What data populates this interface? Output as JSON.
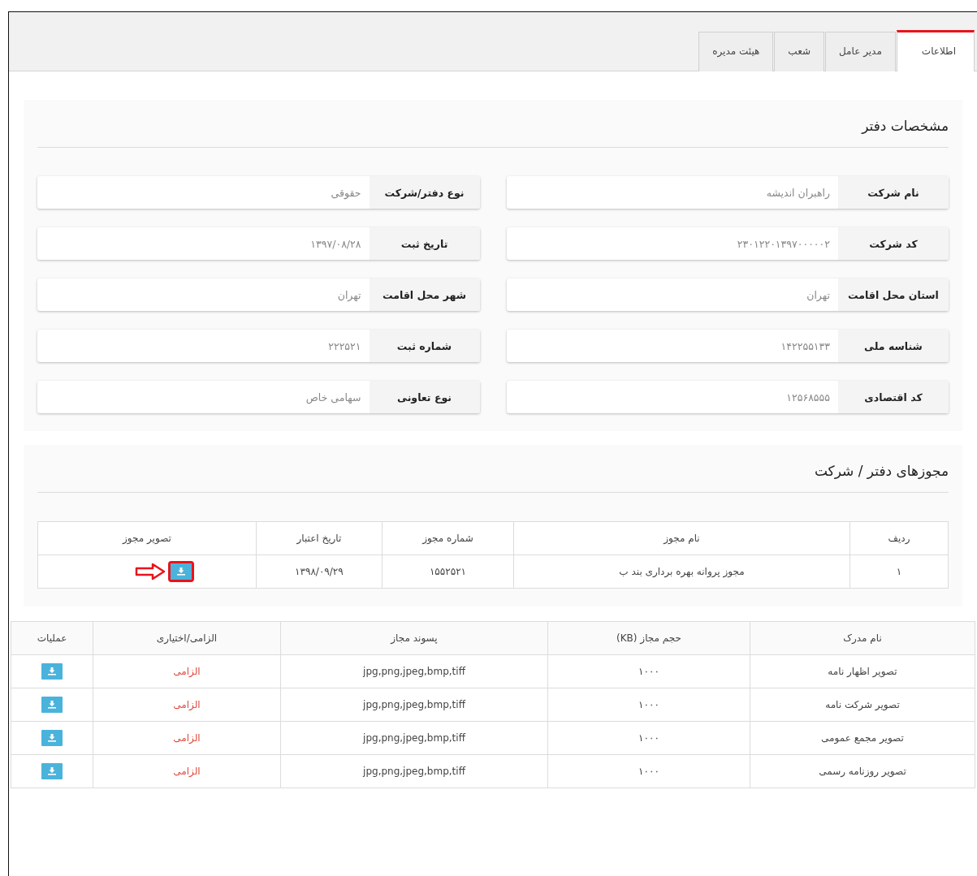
{
  "tabs": [
    {
      "label": "اطلاعات",
      "selected": true
    },
    {
      "label": "مدیر عامل",
      "selected": false
    },
    {
      "label": "شعب",
      "selected": false
    },
    {
      "label": "هیئت مدیره",
      "selected": false
    }
  ],
  "office_details": {
    "title": "مشخصات دفتر",
    "fields": [
      {
        "label": "نام شرکت",
        "value": "راهبران اندیشه"
      },
      {
        "label": "نوع دفتر/شرکت",
        "value": "حقوقی"
      },
      {
        "label": "کد شرکت",
        "value": "۲۳۰۱۲۲۰۱۳۹۷۰۰۰۰۰۲"
      },
      {
        "label": "تاریخ ثبت",
        "value": "۱۳۹۷/۰۸/۲۸"
      },
      {
        "label": "استان محل اقامت",
        "value": "تهران"
      },
      {
        "label": "شهر محل اقامت",
        "value": "تهران"
      },
      {
        "label": "شناسه ملی",
        "value": "۱۴۲۲۵۵۱۳۳"
      },
      {
        "label": "شماره ثبت",
        "value": "۲۲۲۵۲۱"
      },
      {
        "label": "کد اقتصادی",
        "value": "۱۲۵۶۸۵۵۵"
      },
      {
        "label": "نوع تعاونی",
        "value": "سهامی خاص"
      }
    ]
  },
  "licenses": {
    "title": "مجوزهای دفتر / شرکت",
    "columns": [
      "ردیف",
      "نام مجوز",
      "شماره مجوز",
      "تاریخ اعتبار",
      "تصویر مجوز"
    ],
    "rows": [
      {
        "index": "۱",
        "name": "مجوز پروانه بهره برداری بند ب",
        "number": "۱۵۵۲۵۲۱",
        "expiry": "۱۳۹۸/۰۹/۲۹",
        "highlighted": true
      }
    ]
  },
  "documents": {
    "columns": [
      "نام مدرک",
      "حجم مجاز (KB)",
      "پسوند مجاز",
      "الزامی/اختیاری",
      "عملیات"
    ],
    "rows": [
      {
        "name": "تصویر اظهار نامه",
        "size": "۱۰۰۰",
        "extensions": "jpg,png,jpeg,bmp,tiff",
        "requirement": "الزامی",
        "required": true
      },
      {
        "name": "تصویر شرکت نامه",
        "size": "۱۰۰۰",
        "extensions": "jpg,png,jpeg,bmp,tiff",
        "requirement": "الزامی",
        "required": true
      },
      {
        "name": "تصویر مجمع عمومی",
        "size": "۱۰۰۰",
        "extensions": "jpg,png,jpeg,bmp,tiff",
        "requirement": "الزامی",
        "required": true
      },
      {
        "name": "تصویر روزنامه رسمی",
        "size": "۱۰۰۰",
        "extensions": "jpg,png,jpeg,bmp,tiff",
        "requirement": "الزامی",
        "required": true
      }
    ]
  }
}
